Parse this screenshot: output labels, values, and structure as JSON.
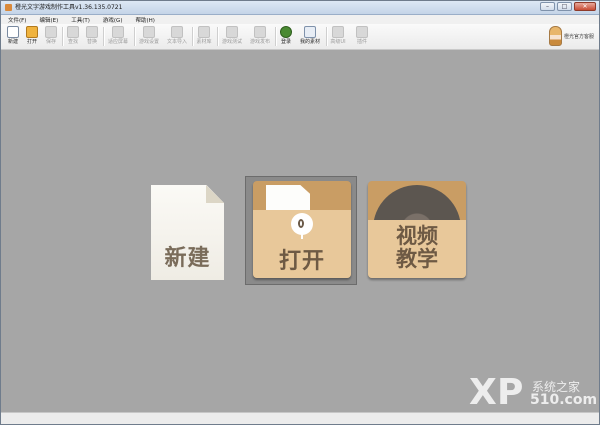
{
  "window": {
    "title": "橙光文字游戏制作工具v1.36.135.0721",
    "controls": {
      "minimize": "–",
      "maximize": "□",
      "close": "✕"
    }
  },
  "menu": [
    {
      "label": "文件(F)"
    },
    {
      "label": "编辑(E)"
    },
    {
      "label": "工具(T)"
    },
    {
      "label": "游戏(G)"
    },
    {
      "label": "帮助(H)"
    }
  ],
  "toolbar": {
    "new": "新建",
    "open": "打开",
    "save": "保存",
    "find": "查找",
    "replace": "替换",
    "fit_screen": "适应屏幕",
    "game_settings": "游戏设置",
    "text_import": "文本导入",
    "material_library": "素材库",
    "game_test": "游戏测试",
    "game_publish": "游戏发布",
    "login": "登录",
    "my_material": "我的素材",
    "advanced_ui": "高级UI",
    "plugins": "插件"
  },
  "brand": {
    "text": "橙光官方客服",
    "icon": "mascot-avatar-icon"
  },
  "home": {
    "new_label": "新建",
    "open_label": "打开",
    "video_line1": "视频",
    "video_line2": "教学",
    "selected": "open"
  },
  "watermark": {
    "logo_x": "X",
    "logo_p": "P",
    "line1": "系统之家",
    "line2": "510.com"
  },
  "colors": {
    "content_bg": "#a6a6a6",
    "card_tan": "#c99d64",
    "card_light": "#e8c89a",
    "label_brown": "#6e5a44"
  }
}
